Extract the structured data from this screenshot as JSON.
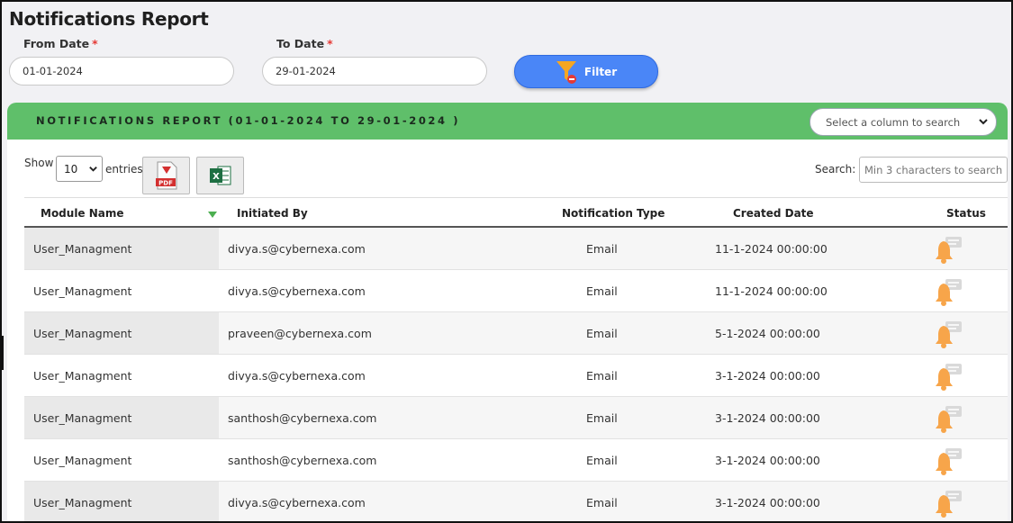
{
  "page": {
    "title": "Notifications Report"
  },
  "filters": {
    "from_label": "From Date",
    "to_label": "To Date",
    "required_mark": "*",
    "from_value": "01-01-2024",
    "to_value": "29-01-2024",
    "filter_label": "Filter"
  },
  "report": {
    "title": "NOTIFICATIONS REPORT (01-01-2024 TO 29-01-2024 )",
    "column_select": "Select a column to search",
    "show_label": "Show",
    "entries_value": "10",
    "entries_label": "entries",
    "search_label": "Search:",
    "search_placeholder": "Min 3 characters to search"
  },
  "table": {
    "headers": [
      "Module Name",
      "Initiated By",
      "Notification Type",
      "Created Date",
      "Status"
    ],
    "rows": [
      {
        "module": "User_Managment",
        "initiated_by": "divya.s@cybernexa.com",
        "type": "Email",
        "created": "11-1-2024 00:00:00"
      },
      {
        "module": "User_Managment",
        "initiated_by": "divya.s@cybernexa.com",
        "type": "Email",
        "created": "11-1-2024 00:00:00"
      },
      {
        "module": "User_Managment",
        "initiated_by": "praveen@cybernexa.com",
        "type": "Email",
        "created": "5-1-2024 00:00:00"
      },
      {
        "module": "User_Managment",
        "initiated_by": "divya.s@cybernexa.com",
        "type": "Email",
        "created": "3-1-2024 00:00:00"
      },
      {
        "module": "User_Managment",
        "initiated_by": "santhosh@cybernexa.com",
        "type": "Email",
        "created": "3-1-2024 00:00:00"
      },
      {
        "module": "User_Managment",
        "initiated_by": "santhosh@cybernexa.com",
        "type": "Email",
        "created": "3-1-2024 00:00:00"
      },
      {
        "module": "User_Managment",
        "initiated_by": "divya.s@cybernexa.com",
        "type": "Email",
        "created": "3-1-2024 00:00:00"
      }
    ]
  },
  "colors": {
    "accent": "#4a86f7",
    "header_green": "#5fbf6a",
    "required": "#e53935"
  },
  "icons": {
    "filter": "funnel-icon",
    "pdf": "pdf-icon",
    "excel": "excel-icon",
    "status": "bell-notification-icon"
  }
}
